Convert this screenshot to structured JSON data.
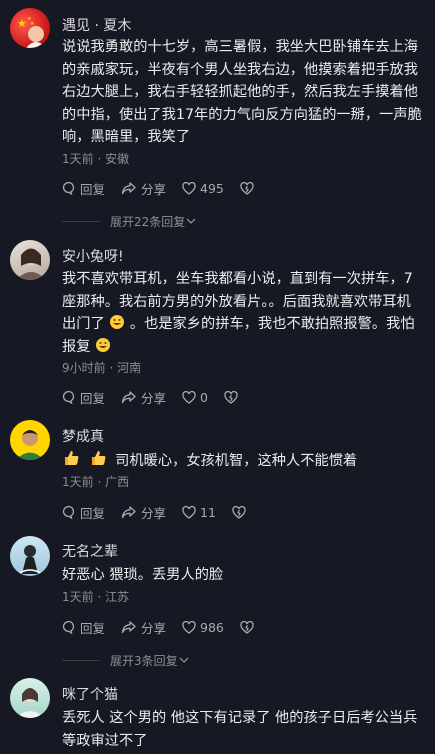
{
  "comments": [
    {
      "author": "遇见 · 夏木",
      "text": "说说我勇敢的十七岁，高三暑假，我坐大巴卧铺车去上海的亲戚家玩，半夜有个男人坐我右边，他摸索着把手放我右边大腿上，我右手轻轻抓起他的手，然后我左手摸着他的中指，使出了我17年的力气向反方向猛的一掰，一声脆响，黑暗里，我笑了",
      "meta": "1天前 · 安徽",
      "reply_label": "回复",
      "share_label": "分享",
      "likes": "495",
      "expand_label": "展开22条回复"
    },
    {
      "author": "安小兔呀!",
      "text_a": "我不喜欢带耳机，坐车我都看小说，直到有一次拼车，7座那种。我右前方男的外放看片。。后面我就喜欢带耳机出门了",
      "text_b": "。也是家乡的拼车，我也不敢拍照报警。我怕报复",
      "meta": "9小时前 · 河南",
      "reply_label": "回复",
      "share_label": "分享",
      "likes": "0"
    },
    {
      "author": "梦成真",
      "text": "司机暖心，女孩机智，这种人不能惯着",
      "meta": "1天前 · 广西",
      "reply_label": "回复",
      "share_label": "分享",
      "likes": "11"
    },
    {
      "author": "无名之辈",
      "text": "好恶心 猥琐。丢男人的脸",
      "meta": "1天前 · 江苏",
      "reply_label": "回复",
      "share_label": "分享",
      "likes": "986",
      "expand_label": "展开3条回复"
    },
    {
      "author": "咪了个猫",
      "text": "丢死人 这个男的 他这下有记录了 他的孩子日后考公当兵等政审过不了"
    }
  ]
}
